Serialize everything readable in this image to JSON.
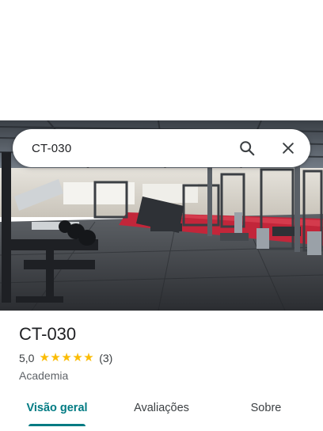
{
  "search": {
    "query": "CT-030",
    "search_icon": "search-icon",
    "close_icon": "close-icon"
  },
  "place": {
    "name": "CT-030",
    "rating": "5,0",
    "stars": 5,
    "review_count": "(3)",
    "category": "Academia"
  },
  "tabs": [
    {
      "label": "Visão geral",
      "active": true
    },
    {
      "label": "Avaliações",
      "active": false
    },
    {
      "label": "Sobre",
      "active": false
    }
  ],
  "colors": {
    "accent": "#007b83",
    "star": "#fbbc04"
  }
}
